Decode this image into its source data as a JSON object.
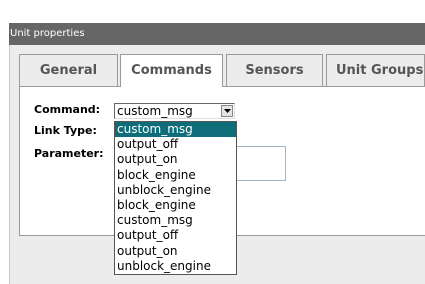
{
  "window": {
    "title": "Unit properties"
  },
  "tabs": [
    {
      "label": "General",
      "active": false
    },
    {
      "label": "Commands",
      "active": true
    },
    {
      "label": "Sensors",
      "active": false
    },
    {
      "label": "Unit Groups",
      "active": false
    }
  ],
  "form": {
    "command_label": "Command:",
    "link_type_label": "Link Type:",
    "parameter_label": "Parameter:",
    "parameter_value": ""
  },
  "command_select": {
    "value": "custom_msg",
    "expanded": true,
    "selected_index": 0,
    "options": [
      "custom_msg",
      "output_off",
      "output_on",
      "block_engine",
      "unblock_engine",
      "block_engine",
      "custom_msg",
      "output_off",
      "output_on",
      "unblock_engine"
    ]
  },
  "colors": {
    "title_bar": "#666666",
    "selection": "#0f6d7a",
    "tab_background": "#ececec"
  }
}
